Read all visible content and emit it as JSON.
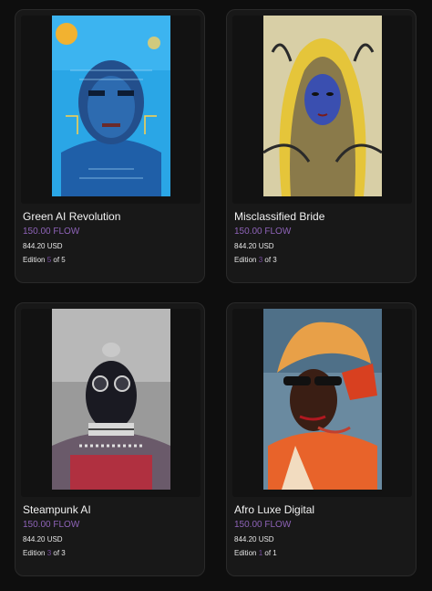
{
  "cards": [
    {
      "title": "Green AI Revolution",
      "price": "150.00 FLOW",
      "usd": "844.20 USD",
      "edition_prefix": "Edition",
      "edition_num": "5",
      "edition_suffix": "of 5",
      "image": "portrait-blue-circuit-man"
    },
    {
      "title": "Misclassified Bride",
      "price": "150.00 FLOW",
      "usd": "844.20 USD",
      "edition_prefix": "Edition",
      "edition_num": "3",
      "edition_suffix": "of 3",
      "image": "portrait-woman-gold-veil"
    },
    {
      "title": "Steampunk AI",
      "price": "150.00 FLOW",
      "usd": "844.20 USD",
      "edition_prefix": "Edition",
      "edition_num": "3",
      "edition_suffix": "of 3",
      "image": "portrait-steampunk-goggles"
    },
    {
      "title": "Afro Luxe Digital",
      "price": "150.00 FLOW",
      "usd": "844.20 USD",
      "edition_prefix": "Edition",
      "edition_num": "1",
      "edition_suffix": "of 1",
      "image": "portrait-woman-sunglasses-headwrap"
    }
  ],
  "colors": {
    "background": "#0e0e0e",
    "card": "#181818",
    "price": "#8e63b8",
    "edition_accent": "#7a4fa3"
  }
}
